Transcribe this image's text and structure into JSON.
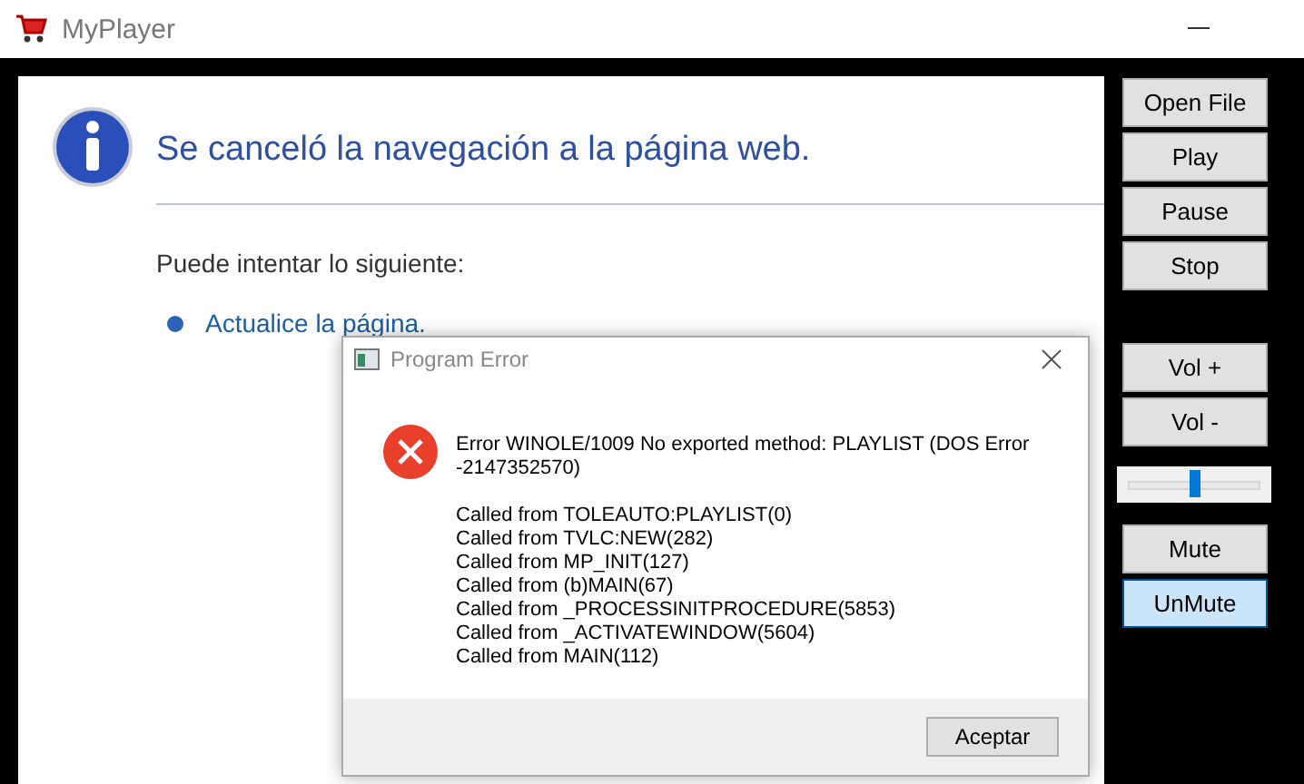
{
  "window": {
    "title": "MyPlayer"
  },
  "browser": {
    "heading": "Se canceló la navegación a la página web.",
    "intro": "Puede intentar lo siguiente:",
    "suggestions": [
      "Actualice la página."
    ]
  },
  "controls": [
    {
      "kind": "buttons",
      "items": [
        {
          "label": "Open File",
          "focused": false
        },
        {
          "label": "Play",
          "focused": false
        },
        {
          "label": "Pause",
          "focused": false
        },
        {
          "label": "Stop",
          "focused": false
        }
      ]
    },
    {
      "kind": "buttons",
      "items": [
        {
          "label": "Vol +",
          "focused": false
        },
        {
          "label": "Vol -",
          "focused": false
        }
      ]
    },
    {
      "kind": "slider",
      "level": 0.5
    },
    {
      "kind": "buttons",
      "items": [
        {
          "label": "Mute",
          "focused": false
        },
        {
          "label": "UnMute",
          "focused": true
        }
      ]
    }
  ],
  "dialog": {
    "title": "Program Error",
    "message": "Error WINOLE/1009  No exported method: PLAYLIST (DOS Error -2147352570)",
    "trace": [
      "Called from TOLEAUTO:PLAYLIST(0)",
      "Called from TVLC:NEW(282)",
      "Called from MP_INIT(127)",
      "Called from (b)MAIN(67)",
      "Called from _PROCESSINITPROCEDURE(5853)",
      "Called from _ACTIVATEWINDOW(5604)",
      "Called from MAIN(112)"
    ],
    "button": "Aceptar"
  }
}
